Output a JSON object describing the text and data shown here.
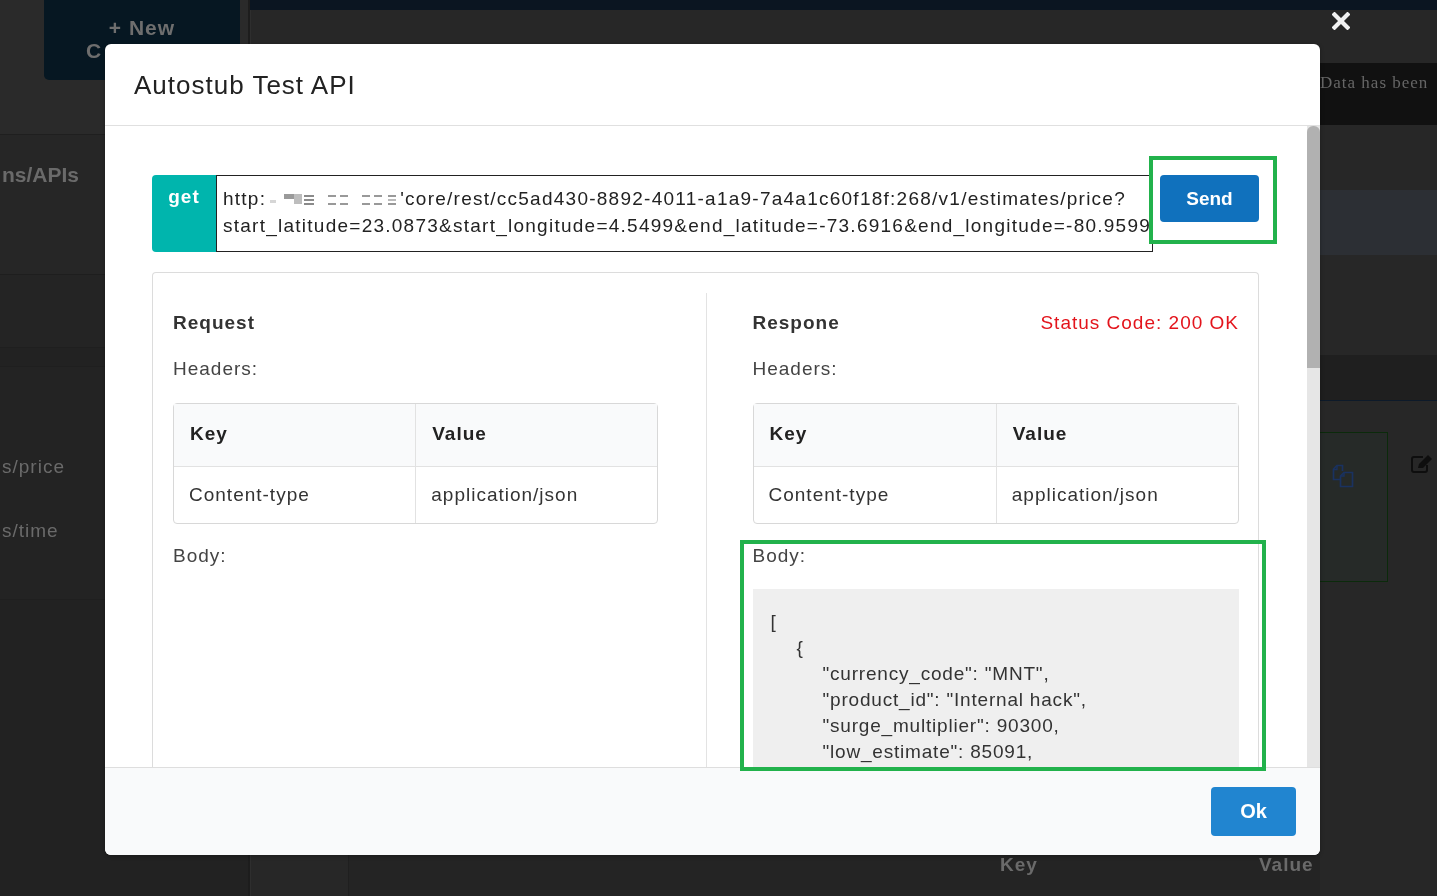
{
  "background": {
    "sidebar": {
      "new_button": [
        "+ New",
        "C"
      ],
      "heading": "ns/APIs",
      "items": [
        "s/price",
        "s/time"
      ]
    },
    "notice": "Data has been",
    "table": {
      "columns": [
        "Key",
        "Value"
      ]
    }
  },
  "dialog": {
    "title": "Autostub Test API",
    "request_bar": {
      "method": "get",
      "url": {
        "scheme": "http:",
        "path": "'core/rest/cc5ad430-8892-4011-a1a9-7a4a1c60f18f:268/v1/estimates/price?",
        "query": "start_latitude=23.0873&start_longitude=4.5499&end_latitude=-73.6916&end_longitude=-80.9599"
      },
      "send": {
        "label": "Send",
        "highlighted": true
      }
    },
    "request": {
      "title": "Request",
      "headers_label": "Headers:",
      "columns": [
        "Key",
        "Value"
      ],
      "rows": [
        [
          "Content-type",
          "application/json"
        ]
      ],
      "body_label": "Body:"
    },
    "response": {
      "title": "Respone",
      "status": "Status Code: 200 OK",
      "headers_label": "Headers:",
      "columns": [
        "Key",
        "Value"
      ],
      "rows": [
        [
          "Content-type",
          "application/json"
        ]
      ],
      "body_label": "Body:",
      "body": "[\n\t{\n\t\t\"currency_code\": \"MNT\",\n\t\t\"product_id\": \"Internal hack\",\n\t\t\"surge_multiplier\": 90300,\n\t\t\"low_estimate\": 85091,",
      "body_highlighted": true
    },
    "footer": {
      "ok": "Ok"
    }
  }
}
